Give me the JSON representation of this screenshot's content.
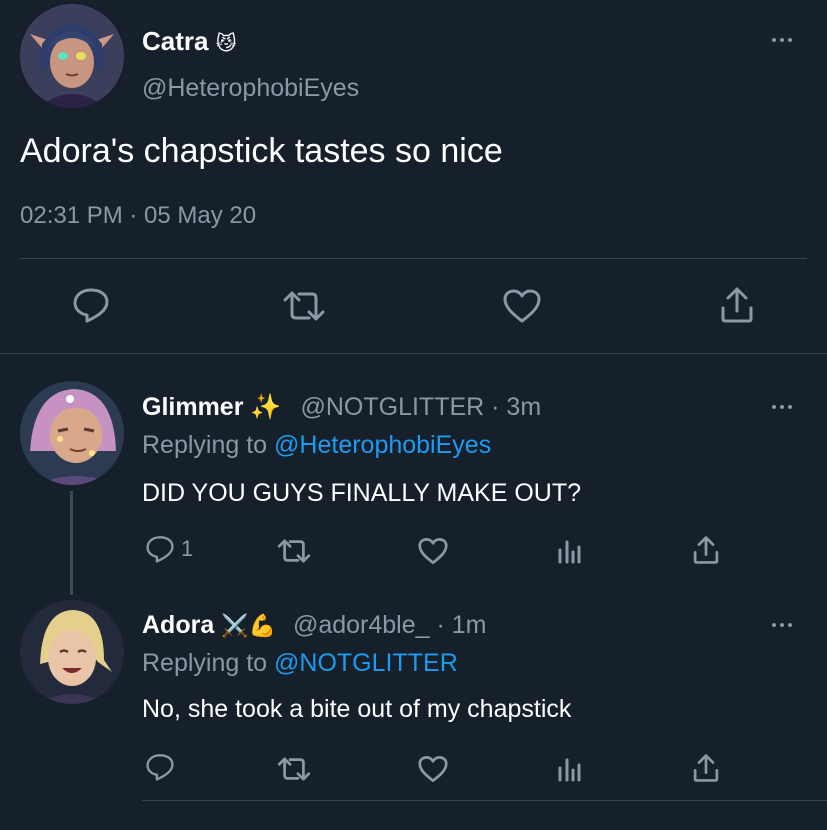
{
  "main_tweet": {
    "author_name": "Catra",
    "author_emoji": "😼",
    "handle": "@HeterophobiEyes",
    "text": "Adora's chapstick tastes so nice",
    "timestamp": "02:31 PM · 05 May 20",
    "actions": [
      "reply-icon",
      "retweet-icon",
      "like-icon",
      "share-icon"
    ]
  },
  "replies": [
    {
      "author_name": "Glimmer",
      "author_emoji": "✨",
      "handle": "@NOTGLITTER · 3m",
      "replying_prefix": "Replying to",
      "replying_to": "@HeterophobiEyes",
      "text": "DID YOU GUYS FINALLY MAKE OUT?",
      "reply_count": "1"
    },
    {
      "author_name": "Adora",
      "author_emoji": "⚔️💪",
      "handle": "@ador4ble_ · 1m",
      "replying_prefix": "Replying to",
      "replying_to": "@NOTGLITTER",
      "text": "No, she took a bite out of my chapstick",
      "reply_count": ""
    }
  ],
  "colors": {
    "background": "#15202b",
    "muted": "#8b98a5",
    "link": "#1d9bf0",
    "divider": "#38444d"
  }
}
